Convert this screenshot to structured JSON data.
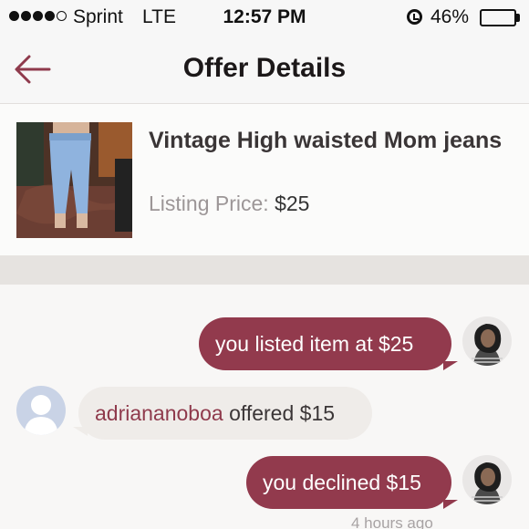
{
  "status_bar": {
    "carrier": "Sprint",
    "network": "LTE",
    "time": "12:57 PM",
    "battery_percent": "46%",
    "battery_level": 0.46,
    "signal_bars_filled": 4,
    "signal_bars_total": 5
  },
  "nav": {
    "title": "Offer Details",
    "back_icon": "arrow-left-icon"
  },
  "listing": {
    "title": "Vintage High waisted Mom jeans",
    "price_label": "Listing Price:",
    "price_value": "$25"
  },
  "messages": [
    {
      "from": "me",
      "text": "you listed item at $25"
    },
    {
      "from": "them",
      "username": "adriananoboa",
      "text": " offered $15"
    },
    {
      "from": "me",
      "text": "you declined $15"
    }
  ],
  "timestamp": "4 hours ago",
  "colors": {
    "accent": "#923a4d",
    "incoming_bubble": "#efece9",
    "background": "#f8f7f6",
    "band": "#e6e3e0"
  }
}
